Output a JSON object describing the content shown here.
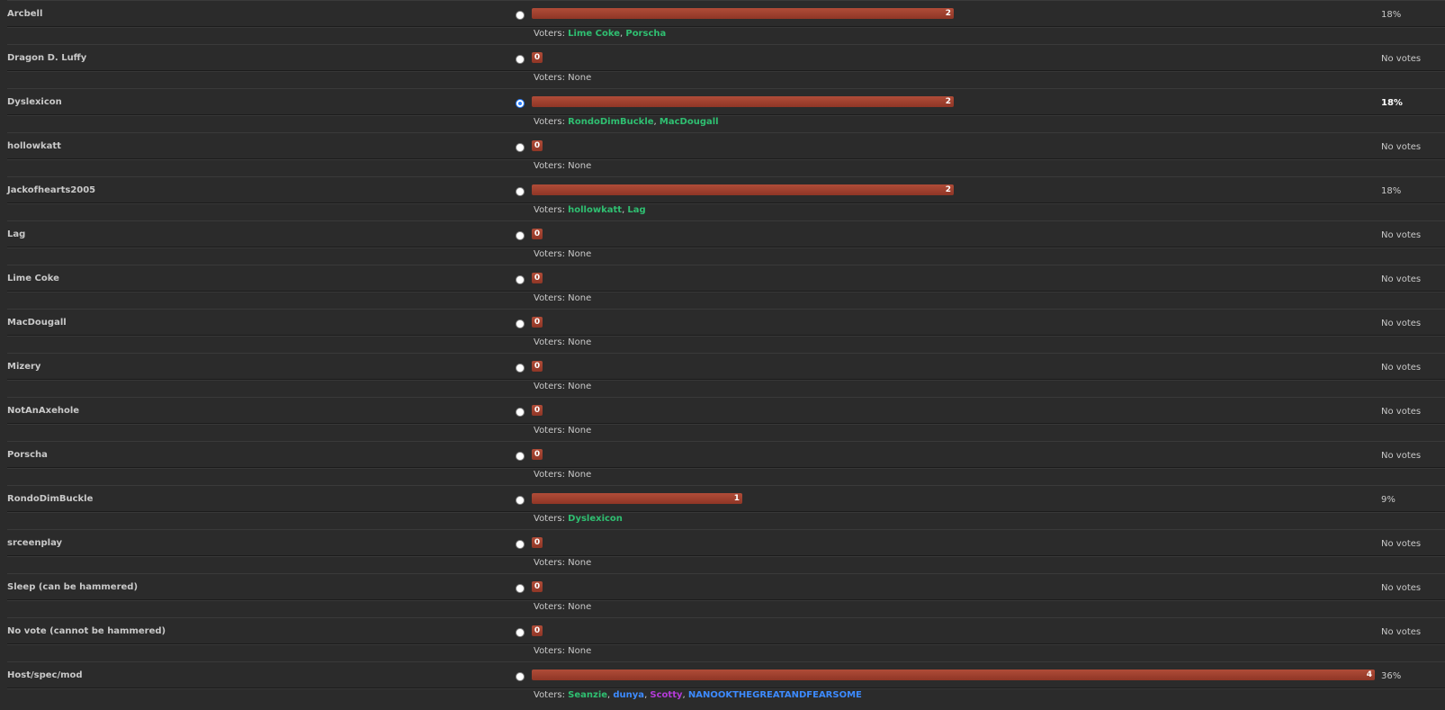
{
  "voters_label": "Voters:",
  "max_votes": 4,
  "options": [
    {
      "name": "Arcbell",
      "votes": 2,
      "votes_label": "2",
      "pct": "18%",
      "checked": false,
      "voters": [
        {
          "name": "Lime Coke",
          "color": "green"
        },
        {
          "name": "Porscha",
          "color": "green"
        }
      ]
    },
    {
      "name": "Dragon D. Luffy",
      "votes": 0,
      "votes_label": "0",
      "pct": "No votes",
      "checked": false,
      "voters": []
    },
    {
      "name": "Dyslexicon",
      "votes": 2,
      "votes_label": "2",
      "pct": "18%",
      "checked": true,
      "voters": [
        {
          "name": "RondoDimBuckle",
          "color": "green"
        },
        {
          "name": "MacDougall",
          "color": "green"
        }
      ]
    },
    {
      "name": "hollowkatt",
      "votes": 0,
      "votes_label": "0",
      "pct": "No votes",
      "checked": false,
      "voters": []
    },
    {
      "name": "Jackofhearts2005",
      "votes": 2,
      "votes_label": "2",
      "pct": "18%",
      "checked": false,
      "voters": [
        {
          "name": "hollowkatt",
          "color": "green"
        },
        {
          "name": "Lag",
          "color": "green"
        }
      ]
    },
    {
      "name": "Lag",
      "votes": 0,
      "votes_label": "0",
      "pct": "No votes",
      "checked": false,
      "voters": []
    },
    {
      "name": "Lime Coke",
      "votes": 0,
      "votes_label": "0",
      "pct": "No votes",
      "checked": false,
      "voters": []
    },
    {
      "name": "MacDougall",
      "votes": 0,
      "votes_label": "0",
      "pct": "No votes",
      "checked": false,
      "voters": []
    },
    {
      "name": "Mizery",
      "votes": 0,
      "votes_label": "0",
      "pct": "No votes",
      "checked": false,
      "voters": []
    },
    {
      "name": "NotAnAxehole",
      "votes": 0,
      "votes_label": "0",
      "pct": "No votes",
      "checked": false,
      "voters": []
    },
    {
      "name": "Porscha",
      "votes": 0,
      "votes_label": "0",
      "pct": "No votes",
      "checked": false,
      "voters": []
    },
    {
      "name": "RondoDimBuckle",
      "votes": 1,
      "votes_label": "1",
      "pct": "9%",
      "checked": false,
      "voters": [
        {
          "name": "Dyslexicon",
          "color": "green"
        }
      ]
    },
    {
      "name": "srceenplay",
      "votes": 0,
      "votes_label": "0",
      "pct": "No votes",
      "checked": false,
      "voters": []
    },
    {
      "name": "Sleep (can be hammered)",
      "votes": 0,
      "votes_label": "0",
      "pct": "No votes",
      "checked": false,
      "voters": []
    },
    {
      "name": "No vote (cannot be hammered)",
      "votes": 0,
      "votes_label": "0",
      "pct": "No votes",
      "checked": false,
      "voters": []
    },
    {
      "name": "Host/spec/mod",
      "votes": 4,
      "votes_label": "4",
      "pct": "36%",
      "checked": false,
      "voters": [
        {
          "name": "Seanzie",
          "color": "green"
        },
        {
          "name": "dunya",
          "color": "blue"
        },
        {
          "name": "Scotty",
          "color": "purple"
        },
        {
          "name": "NANOOKTHEGREATANDFEARSOME",
          "color": "blue"
        }
      ]
    }
  ],
  "none_label": "None"
}
